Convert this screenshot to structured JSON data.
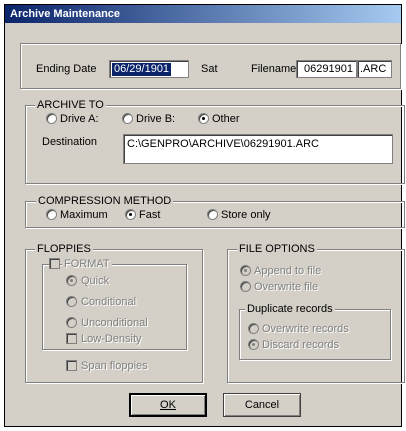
{
  "window": {
    "title": "Archive Maintenance"
  },
  "top": {
    "ending_date_label": "Ending Date",
    "ending_date_value": "06/29/1901",
    "day_label": "Sat",
    "filename_label": "Filename",
    "filename_value": "06291901",
    "extension_value": ".ARC"
  },
  "archive_to": {
    "legend": "ARCHIVE TO",
    "options": [
      {
        "label": "Drive A:",
        "selected": false
      },
      {
        "label": "Drive B:",
        "selected": false
      },
      {
        "label": "Other",
        "selected": true
      }
    ],
    "destination_label": "Destination",
    "destination_value": "C:\\GENPRO\\ARCHIVE\\06291901.ARC"
  },
  "compression": {
    "legend": "COMPRESSION METHOD",
    "options": [
      {
        "label": "Maximum",
        "selected": false
      },
      {
        "label": "Fast",
        "selected": true
      },
      {
        "label": "Store only",
        "selected": false
      }
    ]
  },
  "floppies": {
    "legend": "FLOPPIES",
    "format_label": "FORMAT",
    "format_options": [
      {
        "label": "Quick",
        "selected": true
      },
      {
        "label": "Conditional",
        "selected": false
      },
      {
        "label": "Unconditional",
        "selected": false
      }
    ],
    "low_density_label": "Low-Density",
    "span_label": "Span floppies"
  },
  "file_options": {
    "legend": "FILE OPTIONS",
    "append_label": "Append to file",
    "overwrite_label": "Overwrite file",
    "duplicate_legend": "Duplicate records",
    "overwrite_records_label": "Overwrite records",
    "discard_records_label": "Discard records"
  },
  "buttons": {
    "ok_label": "OK",
    "cancel_label": "Cancel"
  }
}
